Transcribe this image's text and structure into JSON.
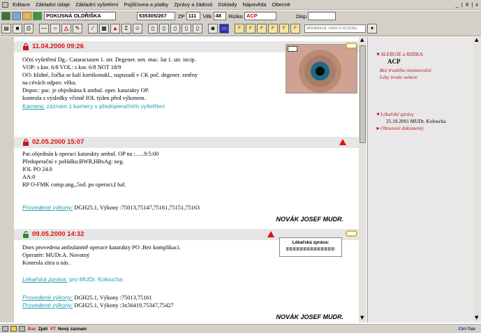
{
  "menu": {
    "items": [
      "Editace",
      "Základní údaje",
      "Základní vyšetření",
      "Pojišťovna a platby",
      "Zprávy a žádosti",
      "Doklady",
      "Nápověda",
      "Obecné"
    ],
    "window_controls": "_ | 8 | x"
  },
  "patient": {
    "name": "POKUSNÁ OLDŘIŠKA",
    "id_number": "535305/267",
    "zp_label": "ZP",
    "zp_value": "111",
    "age_label": "Věk",
    "age_value": "48",
    "risk_label": "Riziko",
    "risk_value": "ACP",
    "disp_label": "Disp"
  },
  "toolbar": {
    "search_placeholder": "AFEBRILNÍ, HRDLO KLIDNÉ,"
  },
  "entries": [
    {
      "date": "11.04.2000 09:26",
      "lines": [
        "Oční vyšetření Dg.: Cataractasen 1. utr.          Degener. sen. mac. lut 1. utr. incip.",
        "VOP: s kor. 6/8 VOL: s kor. 6/8 NOT 18/9",
        "OO: klidné, čočka se kalí kortikonukl., napozadí v CK poč. degener. změny",
        "na cévách odpov. věku.",
        "Dopor.: pac. je objednána k ambul. oper. katarakty OP.",
        "kontrola s výsledky včetně IOL týden před výkonem."
      ],
      "camera_label": "Kamera:",
      "camera_text": "záznam z kamery v předoperačním vyšetření"
    },
    {
      "date": "02.05.2000 15:07",
      "lines": [
        "Pac.objednán k operaci katarakty ambul. OP na :......9:5:00",
        "Předoperační v pořádku.BWR,HBsAg: neg.",
        "IOL PO 24.0",
        "AA:0",
        "RP O-FMK comp.ung.,5xd.  po operaci,I bal."
      ],
      "procedures_label": "Provedené výkony:",
      "procedures_text": "DGH25.1, Výkony :75013,75147,75161,75151,75163",
      "doctor": "NOVÁK JOSEF MUDR."
    },
    {
      "date": "09.05.2000 14:32",
      "lines": [
        "Dnes provedena ambulantně operace katarakty PO .Bez komplikací.",
        "Operatér: MUDr.A. Novotný",
        "Kontrola zítra u nás ."
      ],
      "report_label": "Lékařská zpráva:",
      "report_text": "pro MUDr. Kolоucha",
      "procedures_label_1": "Provedené výkony:",
      "procedures_text_1": "DGH25.1, Výkony :75013,75161",
      "procedures_label_2": "Provedené výkony:",
      "procedures_text_2": "DGH25.1, Výkony :3x56419,75347,75427",
      "doctor": "NOVÁK JOSEF MUDR.",
      "thumb_title": "Lékařská zpráva:"
    }
  ],
  "right_pane": {
    "allergy_heading": "▼ALERGIE a RIZIKA:",
    "allergy_code": "ACP",
    "allergy_line1": "Bez trvalého onemocnění",
    "allergy_line2": "Léky trvale nebere",
    "reports_heading": "▼Lékařské zprávy",
    "report_entry": "25.10.2001 MUDr. Koloucha",
    "images_link": "►Obrazové dokumenty"
  },
  "status": {
    "esc_key": "Esc",
    "esc_label": "Zpět",
    "f7_key": "F7",
    "f7_label": "Nový záznam",
    "right_label": "Ctrl-Tab"
  },
  "colors": {
    "date_red": "#e01010",
    "link_teal": "#20a0b0",
    "risk_red": "#b31b1b"
  }
}
